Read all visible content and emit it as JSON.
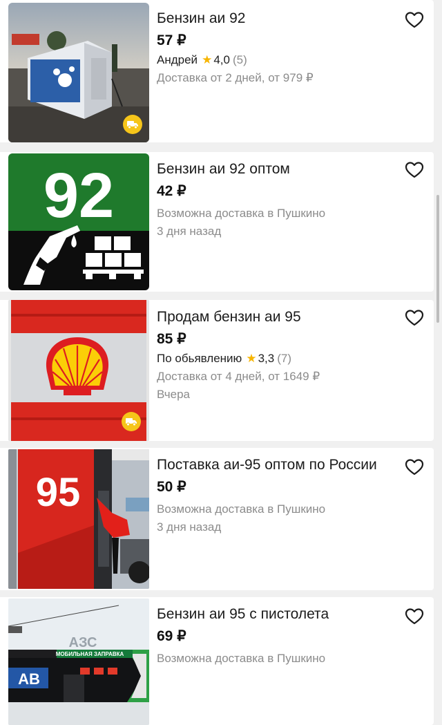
{
  "listings": [
    {
      "title": "Бензин аи 92",
      "price": "57 ₽",
      "seller_name": "Андрей",
      "rating": "4,0",
      "reviews": "(5)",
      "delivery": "Доставка от 2 дней, от 979 ₽",
      "thumb_icon": "gas-station-photo",
      "has_delivery_badge": true
    },
    {
      "title": "Бензин аи 92 оптом",
      "price": "42 ₽",
      "delivery": "Возможна доставка в Пушкино",
      "date": "3 дня назад",
      "thumb_icon": "fuel-92-pallet-icon",
      "thumb_text": "92"
    },
    {
      "title": "Продам бензин аи 95",
      "price": "85 ₽",
      "seller_name": "По обьявлению",
      "rating": "3,3",
      "reviews": "(7)",
      "delivery": "Доставка от 4 дней, от 1649 ₽",
      "date": "Вчера",
      "thumb_icon": "shell-barrel",
      "has_delivery_badge": true
    },
    {
      "title": "Поставка аи-95 оптом по России",
      "price": "50 ₽",
      "delivery": "Возможна доставка в Пушкино",
      "date": "3 дня назад",
      "thumb_icon": "fuel-pump-95",
      "thumb_text": "95"
    },
    {
      "title": "Бензин аи 95 с пистолета",
      "price": "69 ₽",
      "delivery": "Возможна доставка в Пушкино",
      "thumb_icon": "mobile-fuel-station-photo",
      "thumb_text_top": "АЗС",
      "thumb_text_sign": "МОБИЛЬНАЯ ЗАПРАВКА",
      "thumb_text_logo": "АВ"
    }
  ],
  "colors": {
    "star": "#f7b500",
    "badge": "#f6c51a",
    "muted_text": "#8b8b8b",
    "shell_red": "#dd1d21",
    "shell_yellow": "#fbce07",
    "green_92": "#1f7a2c"
  }
}
